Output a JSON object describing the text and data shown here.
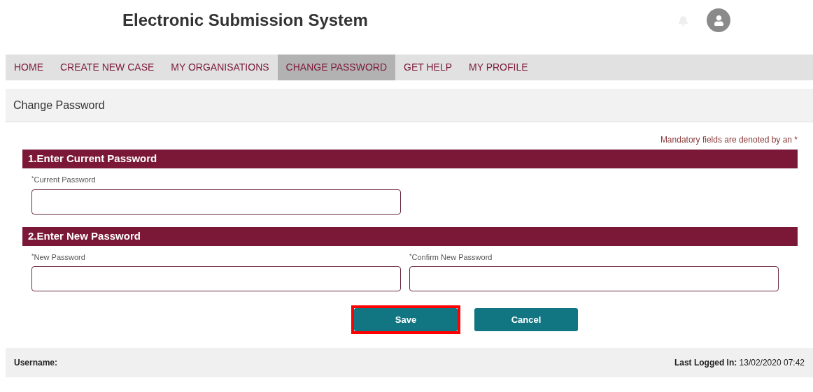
{
  "header": {
    "title": "Electronic Submission System"
  },
  "nav": [
    {
      "label": "HOME",
      "selected": false
    },
    {
      "label": "CREATE NEW CASE",
      "selected": false
    },
    {
      "label": "MY ORGANISATIONS",
      "selected": false
    },
    {
      "label": "CHANGE PASSWORD",
      "selected": true
    },
    {
      "label": "GET HELP",
      "selected": false
    },
    {
      "label": "MY PROFILE",
      "selected": false
    }
  ],
  "page_title": "Change Password",
  "mandatory_note": "Mandatory fields are denoted by an *",
  "sections": [
    {
      "title": "1.Enter Current Password",
      "fields": [
        {
          "mark": "*",
          "label": "Current Password"
        }
      ]
    },
    {
      "title": "2.Enter New Password",
      "fields": [
        {
          "mark": "*",
          "label": "New Password"
        },
        {
          "mark": "*",
          "label": "Confirm New Password"
        }
      ]
    }
  ],
  "buttons": [
    {
      "label": "Save",
      "highlighted": true
    },
    {
      "label": "Cancel",
      "highlighted": false
    }
  ],
  "footer": {
    "username": "Username:",
    "last_login": "**Last Logged In:** 13/02/2020 07:42"
  }
}
